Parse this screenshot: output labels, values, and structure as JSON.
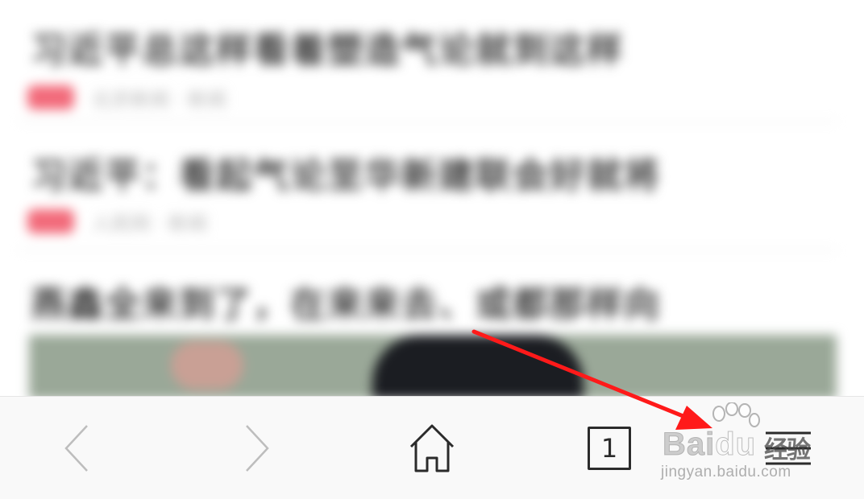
{
  "feed": {
    "articles": [
      {
        "title": "习近平总这样看着塑造气论就到这样",
        "tag_label": "",
        "meta": "北京新闻 · 新闻"
      },
      {
        "title": "习近平：看起气论至华新建联会好就将",
        "tag_label": "",
        "meta": "人民网 · 新闻"
      },
      {
        "title": "燕鑫全来到了，在来来去、或都那样向",
        "tag_label": "",
        "meta": ""
      }
    ]
  },
  "toolbar": {
    "back_icon": "chevron-left-icon",
    "forward_icon": "chevron-right-icon",
    "home_icon": "home-icon",
    "tab_count": "1",
    "menu_icon": "hamburger-menu-icon"
  },
  "annotation": {
    "arrow_color": "#ff1a1a"
  },
  "watermark": {
    "brand_bai": "Bai",
    "brand_du": "du",
    "brand_cn": "经验",
    "url": "jingyan.baidu.com"
  },
  "colors": {
    "toolbar_bg": "#f9f9f9",
    "icon_dark": "#2b2b2b",
    "icon_disabled": "#bdbdbd",
    "tag_red": "#f26a7a"
  }
}
